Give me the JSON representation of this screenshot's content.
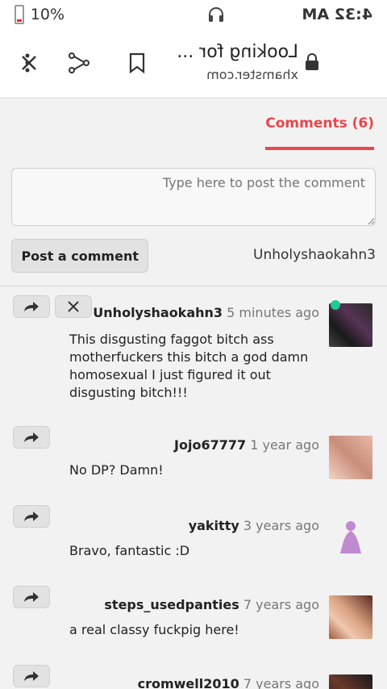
{
  "status_bar": {
    "time": "4:32 AM",
    "battery": "10%"
  },
  "toolbar": {
    "page_title": "Looking for ...",
    "url": "xhamster.com"
  },
  "comments_tab": {
    "label": "Comments (6)"
  },
  "composer": {
    "placeholder": "Type here to post the comment",
    "username": "Unholyshaokahn3",
    "post_label": "Post a comment"
  },
  "comments": [
    {
      "user": "Unholyshaokahn3",
      "time": "5 minutes ago",
      "text": "This disgusting faggot bitch ass motherfuckers this bitch a god damn homosexual I just figured it out disgusting bitch!!!"
    },
    {
      "user": "Jojo67777",
      "time": "1 year ago",
      "text": "No DP? Damn!"
    },
    {
      "user": "yakitty",
      "time": "3 years ago",
      "text": "Bravo, fantastic :D"
    },
    {
      "user": "steps_usedpanties",
      "time": "7 years ago",
      "text": "a real classy fuckpig here!"
    },
    {
      "user": "cromwell2010",
      "time": "7 years ago",
      "text": ""
    }
  ],
  "colors": {
    "accent": "#e8474c",
    "online": "#20c997"
  }
}
